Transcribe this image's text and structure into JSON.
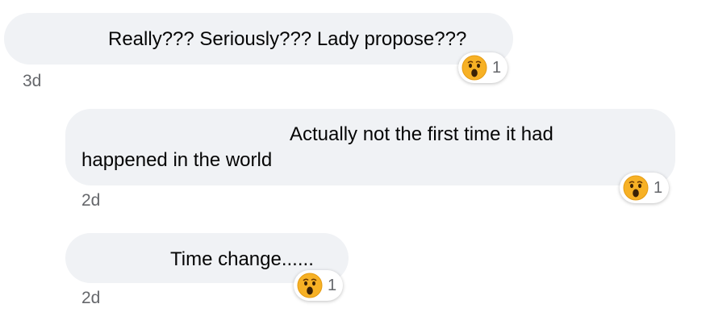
{
  "comments": [
    {
      "text_line1": "Really??? Seriously??? Lady propose???",
      "text_line2": "",
      "time": "3d",
      "reaction": {
        "icon": "wow-emoji-icon",
        "count": "1"
      }
    },
    {
      "text_line1": "Actually not the first time it had",
      "text_line2": "happened in the world",
      "time": "2d",
      "reaction": {
        "icon": "wow-emoji-icon",
        "count": "1"
      }
    },
    {
      "text_line1": "Time change......",
      "text_line2": "",
      "time": "2d",
      "reaction": {
        "icon": "wow-emoji-icon",
        "count": "1"
      }
    }
  ],
  "colors": {
    "bubble_background": "#f0f2f5",
    "text": "#050505",
    "secondary_text": "#65676b"
  }
}
